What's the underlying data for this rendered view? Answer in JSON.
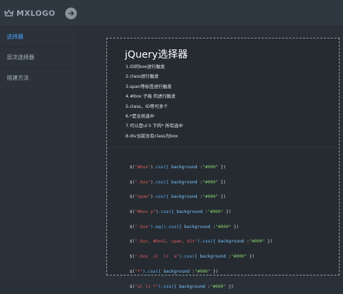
{
  "topbar": {
    "logo_text": "MXLOGO",
    "logo_icon": "crown-icon",
    "toggle_icon": "arrow-right-icon"
  },
  "sidebar": {
    "items": [
      {
        "label": "选择器",
        "active": true
      },
      {
        "label": "层次选择器",
        "active": false
      },
      {
        "label": "搭建方法",
        "active": false
      }
    ]
  },
  "main": {
    "title": "jQuery选择器",
    "notes": [
      "1.ID的box进行触发",
      "2.class进行触发",
      "3.span等标签进行触发",
      "4.#box 子级 的进行触发",
      "5.class，ID等可多个",
      "6.*是全局选中",
      "7.可以是ul li 下的* 所有选中",
      "8.div当前含有class为box"
    ],
    "code_lines": [
      {
        "sel": "\"#box\"",
        "chain": ".css({ ",
        "prop": "background",
        "val": "\"#000\"",
        "tail": " })"
      },
      {
        "sel": "\".box\"",
        "chain": ".css({ ",
        "prop": "background",
        "val": "\"#000\"",
        "tail": " })"
      },
      {
        "sel": "\"span\"",
        "chain": ".css({ ",
        "prop": "background",
        "val": "\"#000\"",
        "tail": " })"
      },
      {
        "sel": "\"#box p\"",
        "chain": ".css({ ",
        "prop": "background",
        "val": "\"#000\"",
        "tail": " })"
      },
      {
        "sel": "\".box\"",
        "chain": ").eq().css({ ",
        "prop": "background",
        "val": "\"#000\"",
        "tail": " })"
      },
      {
        "sel": "\".box, #box2, span, div\"",
        "chain": ").css({ ",
        "prop": "background",
        "val": "\"#000\"",
        "tail": " })"
      },
      {
        "sel": "\".box  ul  li  a\"",
        "chain": ").css({ ",
        "prop": "background",
        "val": "\"#000\"",
        "tail": " })"
      },
      {
        "sel": "\"*\"",
        "chain": ").css({ ",
        "prop": "background",
        "val": "\"#000\"",
        "tail": " })"
      },
      {
        "sel": "\"ul li *\"",
        "chain": ").css({ ",
        "prop": "background",
        "val": "\"#000\"",
        "tail": " })"
      }
    ]
  },
  "colors": {
    "accent": "#4aa3ff",
    "selector": "#e05b5b",
    "string": "#8bd36b",
    "function": "#6ab8ff"
  }
}
